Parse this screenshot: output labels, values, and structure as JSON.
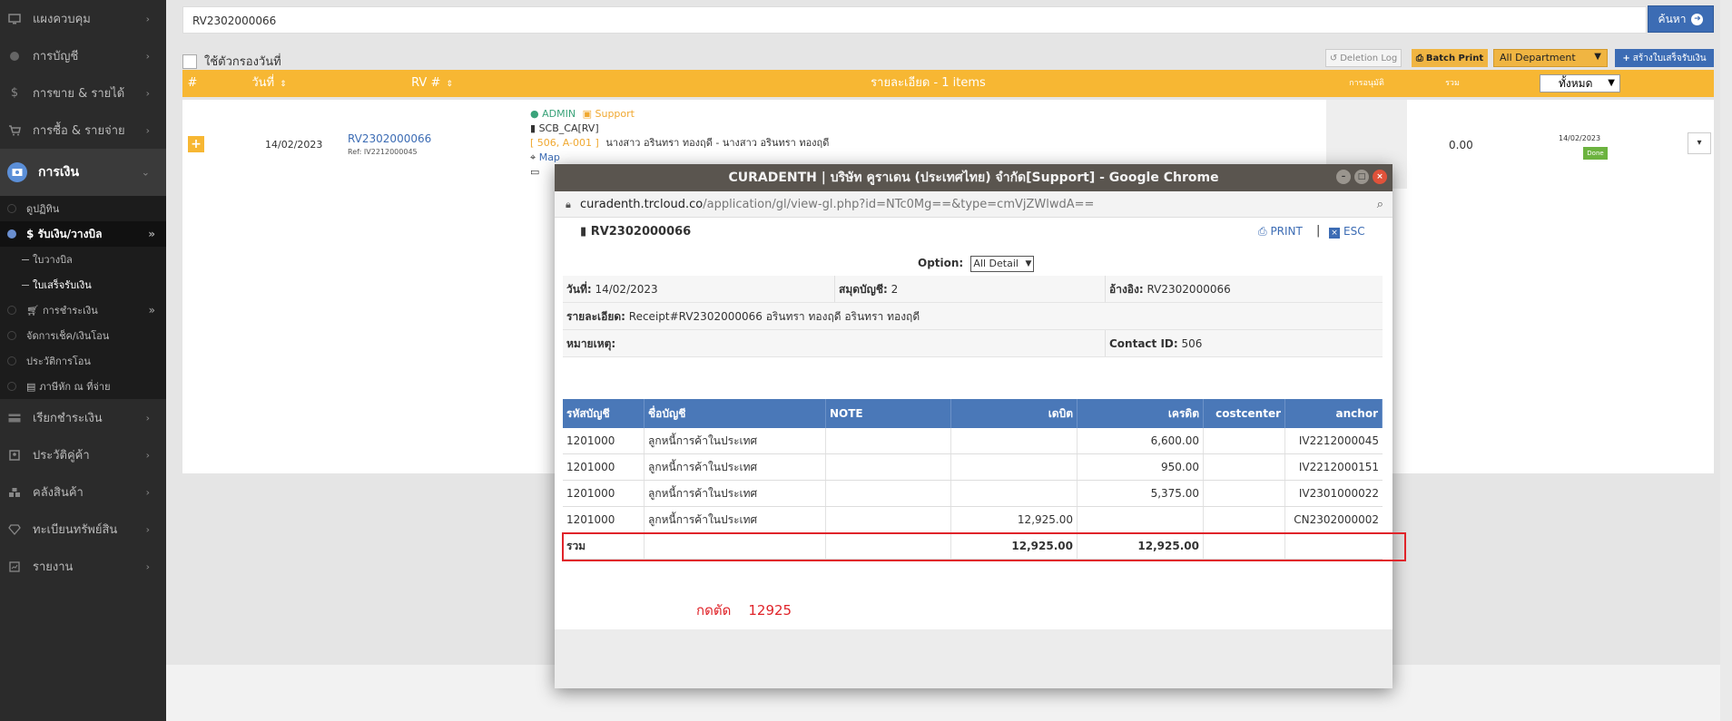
{
  "sidebar": {
    "items": [
      {
        "label": "แผงควบคุม",
        "icon": "monitor-icon"
      },
      {
        "label": "การบัญชี",
        "icon": "book-icon"
      },
      {
        "label": "การขาย & รายได้",
        "icon": "dollar-icon"
      },
      {
        "label": "การซื้อ & รายจ่าย",
        "icon": "cart-icon"
      },
      {
        "label": "การเงิน",
        "icon": "money-icon"
      }
    ],
    "sub_items": [
      {
        "label": "ดูปฏิทิน"
      },
      {
        "label": "$ รับเงิน/วางบิล"
      }
    ],
    "sub_sub_items": [
      {
        "label": "ใบวางบิล"
      },
      {
        "label": "ใบเสร็จรับเงิน"
      }
    ],
    "more_sub_items": [
      {
        "label": "การชำระเงิน"
      },
      {
        "label": "จัดการเช็ค/เงินโอน"
      },
      {
        "label": "ประวัติการโอน"
      },
      {
        "label": "ภาษีหัก ณ ที่จ่าย"
      }
    ],
    "bottom_items": [
      {
        "label": "เรียกชำระเงิน",
        "icon": "card-icon"
      },
      {
        "label": "ประวัติคู่ค้า",
        "icon": "contact-icon"
      },
      {
        "label": "คลังสินค้า",
        "icon": "boxes-icon"
      },
      {
        "label": "ทะเบียนทรัพย์สิน",
        "icon": "diamond-icon"
      },
      {
        "label": "รายงาน",
        "icon": "report-icon"
      }
    ]
  },
  "search": {
    "value": "RV2302000066",
    "button": "ค้นหา"
  },
  "filter": {
    "label": "ใช้ตัวกรองวันที่"
  },
  "toolbar": {
    "deletion_log": "Deletion Log",
    "batch_print": "Batch Print",
    "department": "All Department",
    "create": "สร้างใบเสร็จรับเงิน"
  },
  "table": {
    "headers": {
      "num": "#",
      "date": "วันที่",
      "rv": "RV #",
      "detail": "รายละเอียด - 1 items",
      "approve": "การอนุมัติ",
      "total": "รวม",
      "status": "ทั้งหมด"
    },
    "row": {
      "date": "14/02/2023",
      "rv": "RV2302000066",
      "ref": "Ref: IV2212000045",
      "admin": "ADMIN",
      "support": "Support",
      "bank": "SCB_CA[RV]",
      "code": "[ 506, A-001 ]",
      "names": "นางสาว อรินทรา ทองฤดี - นางสาว อรินทรา ทองฤดี",
      "map": "Map",
      "amount": "0.00",
      "status_date": "14/02/2023",
      "status": "Done"
    }
  },
  "popup": {
    "title": "CURADENTH | บริษัท คูราเดน (ประเทศไทย) จำกัด[Support] - Google Chrome",
    "url_domain": "curadenth.trcloud.co",
    "url_path": "/application/gl/view-gl.php?id=NTc0Mg==&type=cmVjZWlwdA==",
    "doc_no": "RV2302000066",
    "print": "PRINT",
    "esc": "ESC",
    "option_label": "Option:",
    "option_value": "All Detail",
    "info": {
      "date_label": "วันที่:",
      "date": "14/02/2023",
      "journal_label": "สมุดบัญชี:",
      "journal": "2",
      "ref_label": "อ้างอิง:",
      "ref": "RV2302000066",
      "detail_label": "รายละเอียด:",
      "detail": "Receipt#RV2302000066 อรินทรา ทองฤดี อรินทรา ทองฤดี",
      "remark_label": "หมายเหตุ:",
      "contact_label": "Contact ID:",
      "contact": "506"
    },
    "gl_headers": [
      "รหัสบัญชี",
      "ชื่อบัญชี",
      "NOTE",
      "เดบิต",
      "เครดิต",
      "costcenter",
      "anchor"
    ],
    "gl_rows": [
      [
        "1201000",
        "ลูกหนี้การค้าในประเทศ",
        "",
        "",
        "6,600.00",
        "",
        "IV2212000045"
      ],
      [
        "1201000",
        "ลูกหนี้การค้าในประเทศ",
        "",
        "",
        "950.00",
        "",
        "IV2212000151"
      ],
      [
        "1201000",
        "ลูกหนี้การค้าในประเทศ",
        "",
        "",
        "5,375.00",
        "",
        "IV2301000022"
      ],
      [
        "1201000",
        "ลูกหนี้การค้าในประเทศ",
        "",
        "12,925.00",
        "",
        "",
        "CN2302000002"
      ]
    ],
    "gl_total": [
      "รวม",
      "",
      "",
      "12,925.00",
      "12,925.00",
      "",
      ""
    ],
    "annotation": "กดตัด    12925"
  }
}
